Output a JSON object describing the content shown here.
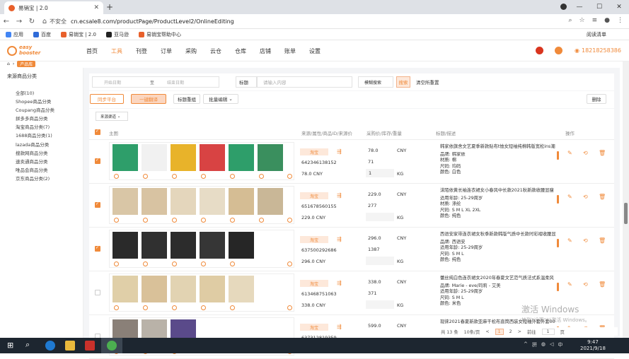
{
  "browser": {
    "tab_title": "易销宝 | 2.0",
    "insecure_label": "不安全",
    "url": "cn.ecsale8.com/productPage/ProductLevel2/OnlineEditing",
    "bookmarks": [
      "应用",
      "百度",
      "易销宝 | 2.0",
      "亚马逊",
      "易销宝帮助中心"
    ],
    "reading_list": "阅读清单"
  },
  "header": {
    "logo_line1": "easy",
    "logo_line2": "booster",
    "nav": [
      "首页",
      "工具",
      "刊登",
      "订单",
      "采购",
      "云仓",
      "仓库",
      "店铺",
      "账单",
      "设置"
    ],
    "active_nav": "工具",
    "phone": "18218258386"
  },
  "breadcrumb": {
    "tag": "产品库"
  },
  "sidebar": {
    "title": "来源商品分类",
    "items": [
      "全部(10)",
      "Shopee商品分类",
      "Coupang商品分类",
      "拼多多商品分类",
      "淘宝商品分类(7)",
      "1688商品分类(1)",
      "lazada商品分类",
      "搜款网商品分类",
      "速卖通商品分类",
      "唯品会商品分类",
      "京东商品分类(2)"
    ]
  },
  "filters": {
    "date_start": "开始日期",
    "date_sep": "至",
    "date_end": "结束日期",
    "title_select": "标题",
    "keyword_placeholder": "请输入内容",
    "fuzzy_select": "模糊搜索",
    "search": "搜索",
    "clear": "清空所重置"
  },
  "actions": {
    "sync": "同步平台",
    "translate": "一键翻译",
    "retitle": "标题重组",
    "batch_edit": "批量编辑",
    "delete": "删除"
  },
  "source_select": "来源渠道",
  "table_headers": {
    "image": "主图",
    "source": "来源/属性/商品ID/来源价",
    "purchase": "采购价/库存/重量",
    "title": "标题/描述",
    "ops": "操作"
  },
  "rows": [
    {
      "checked": true,
      "source": "淘宝",
      "product_id": "642346138152",
      "cny_price": "78.0 CNY",
      "price": "78.0",
      "currency": "CNY",
      "stock": "71",
      "weight": "1",
      "weight_unit": "KG",
      "title": "韩家依旗舍文艺夏季新款贴布t恤女短袖纯棉韩版宽松ins潮",
      "desc": [
        "品牌: 韩家依",
        "材质: 棉",
        "尺码: 均码",
        "颜色: 白色"
      ],
      "thumbs": [
        "#2e9e6a",
        "#f1f1f1",
        "#e8b32a",
        "#d84343",
        "#2e9e6a",
        "#3a8f5e"
      ]
    },
    {
      "checked": true,
      "source": "淘宝",
      "product_id": "651678560155",
      "cny_price": "229.0 CNY",
      "price": "229.0",
      "currency": "CNY",
      "stock": "277",
      "weight": "",
      "weight_unit": "KG",
      "title": "沫陌依黄长袖连衣裙女小春风中长款2021秋新款收腰显瘦",
      "desc": [
        "适用年龄: 25-29周岁",
        "材质: 涤纶",
        "尺码: S M L XL 2XL",
        "颜色: 纯色"
      ],
      "thumbs": [
        "#d9c6a6",
        "#d8c3a2",
        "#e4d6bc",
        "#e7dcc6",
        "#d5bd94",
        "#c9b797"
      ]
    },
    {
      "checked": true,
      "source": "淘宝",
      "product_id": "637500292686",
      "cny_price": "296.0 CNY",
      "price": "296.0",
      "currency": "CNY",
      "stock": "1387",
      "weight": "",
      "weight_unit": "KG",
      "title": "西语安家带连衣裙女秋季新款韩版气质中长款时彩褶收腰显",
      "desc": [
        "品牌: 西语安",
        "适用年龄: 25-29周岁",
        "尺码: S M L",
        "颜色: 纯色"
      ],
      "thumbs": [
        "#2a2a2a",
        "#303030",
        "#2c2c2c",
        "#363636",
        "#262626"
      ]
    },
    {
      "checked": false,
      "source": "淘宝",
      "product_id": "613468751063",
      "cny_price": "338.0 CNY",
      "price": "338.0",
      "currency": "CNY",
      "stock": "371",
      "weight": "",
      "weight_unit": "KG",
      "title": "蕾丝纯白色连衣裙女2020年春夏文艺范气质法式系温柔风",
      "desc": [
        "品牌: Marie - eve/玛莉 - 艾美",
        "适用年龄: 25-29周岁",
        "尺码: S M L",
        "颜色: 米色"
      ],
      "thumbs": [
        "#e0cfa8",
        "#d9c199",
        "#e2d3b2",
        "#dfcca4",
        "#e6d9bd"
      ]
    },
    {
      "checked": false,
      "source": "淘宝",
      "product_id": "637312819359",
      "cny_price": "",
      "price": "599.0",
      "currency": "CNY",
      "stock": "",
      "weight": "",
      "weight_unit": "KG",
      "title": "现徕2021春夏新款亚麻干松布直筒西装女短袖外套外套00",
      "desc": [],
      "thumbs": [
        "#8a8078",
        "#b9b2a8",
        "#5a4a8a"
      ]
    }
  ],
  "pagination": {
    "total": "共 13 条",
    "page_size": "10条/页",
    "prev": "<",
    "current": "1",
    "page2": "2",
    "next": ">",
    "goto": "前往",
    "goto_value": "1",
    "page_suffix": "页"
  },
  "watermark": {
    "line1": "激活 Windows",
    "line2": "转到“设置”以激活 Windows。"
  },
  "clock": {
    "time": "9:47",
    "date": "2021/9/18"
  },
  "tray": [
    "^",
    "拼",
    "中"
  ],
  "colors": {
    "accent": "#f08a3a",
    "taskbar": "#1d2630"
  }
}
